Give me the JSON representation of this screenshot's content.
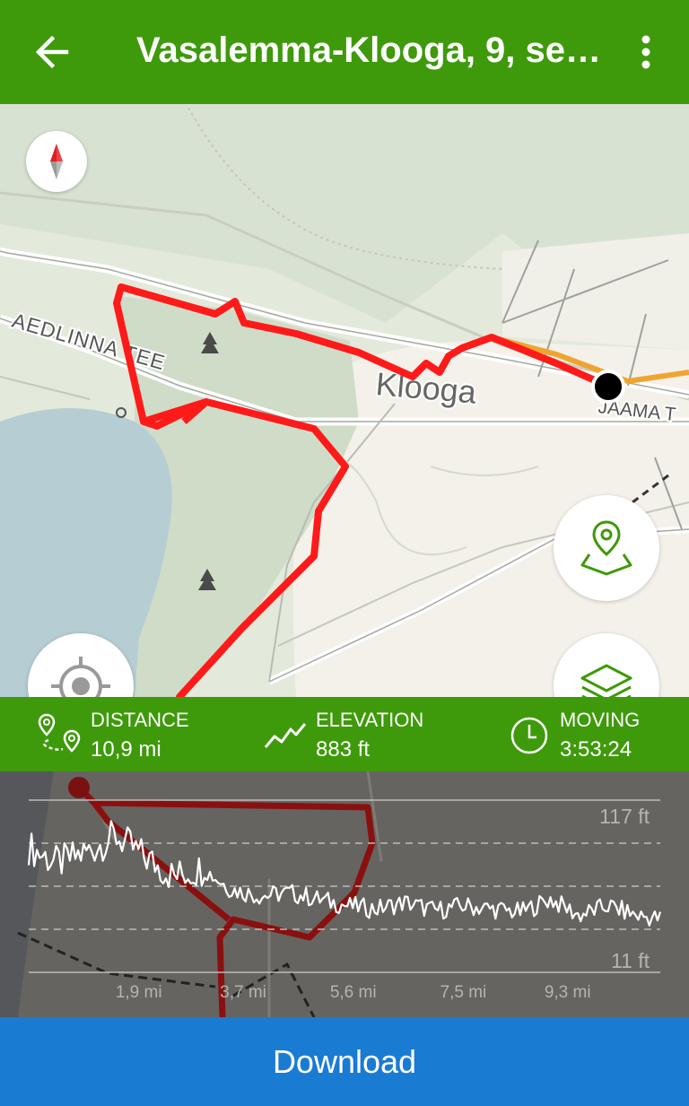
{
  "header": {
    "title": "Vasalemma-Klooga, 9, se…",
    "back_icon": "arrow-left-icon",
    "menu_icon": "more-vertical-icon"
  },
  "map": {
    "labels": {
      "road_aedlinna": "AEDLINNA TEE",
      "town_klooga": "Klooga",
      "road_jaama": "JAAMA T"
    },
    "route_color": "#ff1a1a",
    "compass_icon": "compass-icon",
    "locate_icon": "crosshair-icon",
    "waypoint_icon": "map-pin-area-icon",
    "layers_icon": "layers-icon"
  },
  "stats": {
    "distance": {
      "label": "DISTANCE",
      "value": "10,9 mi"
    },
    "elevation": {
      "label": "ELEVATION",
      "value": "883 ft"
    },
    "moving": {
      "label": "MOVING",
      "value": "3:53:24"
    }
  },
  "profile": {
    "max_label": "117 ft",
    "min_label": "11 ft",
    "x_ticks": [
      "1,9 mi",
      "3,7 mi",
      "5,6 mi",
      "7,5 mi",
      "9,3 mi"
    ]
  },
  "chart_data": {
    "type": "line",
    "title": "",
    "xlabel": "",
    "ylabel": "",
    "x_ticks": [
      "1,9 mi",
      "3,7 mi",
      "5,6 mi",
      "7,5 mi",
      "9,3 mi"
    ],
    "ylim": [
      11,
      117
    ],
    "series": [
      {
        "x": [
          0.0,
          0.5,
          1.0,
          1.5,
          2.0,
          2.5,
          3.0,
          3.5,
          4.0,
          4.5,
          5.0,
          5.5,
          6.0,
          6.5,
          7.0,
          7.5,
          8.0,
          8.5,
          9.0,
          9.5,
          10.0,
          10.5,
          10.9
        ],
        "values": [
          88,
          78,
          85,
          95,
          82,
          70,
          75,
          62,
          58,
          60,
          56,
          52,
          50,
          54,
          49,
          52,
          50,
          48,
          56,
          46,
          52,
          46,
          44
        ]
      }
    ]
  },
  "footer": {
    "download_label": "Download"
  }
}
